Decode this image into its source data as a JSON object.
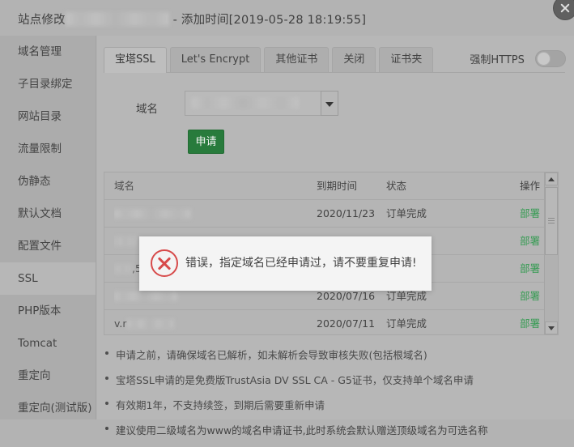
{
  "window": {
    "title_prefix": "站点修改",
    "title_suffix": " - 添加时间[2019-05-28 18:19:55]",
    "close_icon": "close-icon"
  },
  "sidebar": {
    "items": [
      {
        "label": "域名管理",
        "active": false
      },
      {
        "label": "子目录绑定",
        "active": false
      },
      {
        "label": "网站目录",
        "active": false
      },
      {
        "label": "流量限制",
        "active": false
      },
      {
        "label": "伪静态",
        "active": false
      },
      {
        "label": "默认文档",
        "active": false
      },
      {
        "label": "配置文件",
        "active": false
      },
      {
        "label": "SSL",
        "active": true
      },
      {
        "label": "PHP版本",
        "active": false
      },
      {
        "label": "Tomcat",
        "active": false
      },
      {
        "label": "重定向",
        "active": false
      },
      {
        "label": "重定向(测试版)",
        "active": false
      }
    ]
  },
  "tabs": [
    {
      "label": "宝塔SSL",
      "active": true
    },
    {
      "label": "Let's Encrypt",
      "active": false
    },
    {
      "label": "其他证书",
      "active": false
    },
    {
      "label": "关闭",
      "active": false
    },
    {
      "label": "证书夹",
      "active": false
    }
  ],
  "force_https": {
    "label": "强制HTTPS",
    "state": "off"
  },
  "form": {
    "domain_label": "域名",
    "domain_value": "",
    "apply_button": "申请"
  },
  "table": {
    "headers": {
      "domain": "域名",
      "expire": "到期时间",
      "status": "状态",
      "action": "操作"
    },
    "rows": [
      {
        "domain": "",
        "expire": "2020/11/23",
        "status": "订单完成",
        "action": "部署",
        "domain_blur_width": 95
      },
      {
        "domain": "",
        "expire": "",
        "status": "",
        "action": "部署",
        "domain_blur_width": 28
      },
      {
        "domain": ",5",
        "expire": "",
        "status": "",
        "action": "部署",
        "domain_blur_width": 22
      },
      {
        "domain": "",
        "expire": "2020/07/16",
        "status": "订单完成",
        "action": "部署",
        "domain_blur_width": 78
      },
      {
        "domain": "v.r",
        "expire": "2020/07/11",
        "status": "订单完成",
        "action": "部署",
        "domain_blur_width": 58
      }
    ],
    "scrollbar": {
      "up_icon": "caret-up-icon",
      "down_icon": "caret-down-icon"
    }
  },
  "notes": [
    "申请之前，请确保域名已解析，如未解析会导致审核失败(包括根域名)",
    "宝塔SSL申请的是免费版TrustAsia DV SSL CA - G5证书，仅支持单个域名申请",
    "有效期1年，不支持续签，到期后需要重新申请",
    "建议使用二级域名为www的域名申请证书,此时系统会默认赠送顶级域名为可选名称"
  ],
  "error_toast": {
    "icon": "error-circle-x-icon",
    "message": "错误，指定域名已经申请过，请不要重复申请!"
  },
  "colors": {
    "accent_green": "#1f7a35",
    "link_green": "#2f9e4f",
    "error_red": "#e04545",
    "panel_bg": "#bcbcbc",
    "sidebar_bg": "#b0b0b0"
  }
}
